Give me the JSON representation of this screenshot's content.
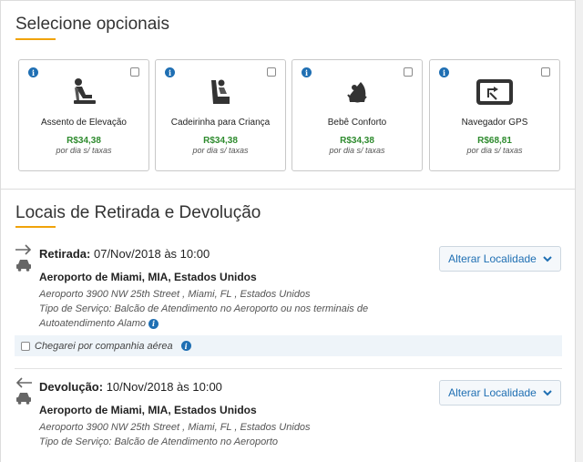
{
  "optionals": {
    "title": "Selecione opcionais",
    "items": [
      {
        "icon": "booster-seat-icon",
        "name": "Assento de Elevação",
        "price": "R$34,38",
        "per": "por dia s/ taxas"
      },
      {
        "icon": "child-seat-icon",
        "name": "Cadeirinha para Criança",
        "price": "R$34,38",
        "per": "por dia s/ taxas"
      },
      {
        "icon": "infant-seat-icon",
        "name": "Bebê Conforto",
        "price": "R$34,38",
        "per": "por dia s/ taxas"
      },
      {
        "icon": "gps-icon",
        "name": "Navegador GPS",
        "price": "R$68,81",
        "per": "por dia s/ taxas"
      }
    ]
  },
  "locations": {
    "title": "Locais de Retirada e Devolução",
    "pickup": {
      "label": "Retirada:",
      "datetime": "07/Nov/2018 às 10:00",
      "place": "Aeroporto de Miami, MIA, Estados Unidos",
      "address": "Aeroporto 3900 NW 25th Street , Miami, FL , Estados Unidos",
      "service": "Tipo de Serviço: Balcão de Atendimento no Aeroporto ou nos terminais de Autoatendimento Alamo",
      "button": "Alterar Localidade"
    },
    "airline_checkbox": "Chegarei por companhia aérea",
    "dropoff": {
      "label": "Devolução:",
      "datetime": "10/Nov/2018 às 10:00",
      "place": "Aeroporto de Miami, MIA, Estados Unidos",
      "address": "Aeroporto 3900 NW 25th Street , Miami, FL , Estados Unidos",
      "service": "Tipo de Serviço: Balcão de Atendimento no Aeroporto",
      "button": "Alterar Localidade"
    }
  },
  "colors": {
    "accent_underline": "#f0a30a",
    "link_blue": "#1f6fb3",
    "price_green": "#2e8b2e"
  }
}
